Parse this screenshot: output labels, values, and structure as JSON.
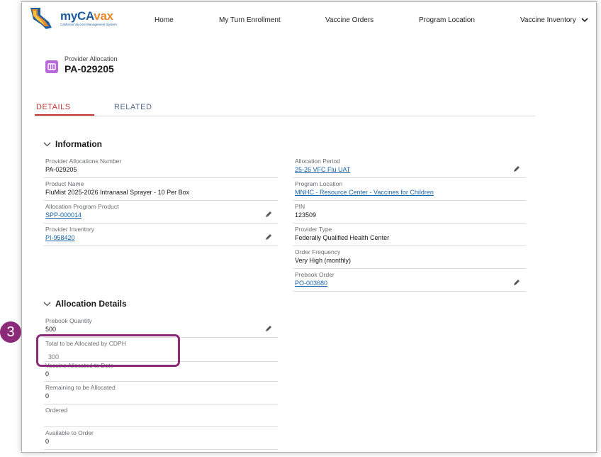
{
  "app": {
    "logo_main_1": "myCA",
    "logo_main_2": "vax",
    "logo_sub": "California Vaccine Management System"
  },
  "nav": {
    "items": [
      "Home",
      "My Turn Enrollment",
      "Vaccine Orders",
      "Program Location",
      "Vaccine Inventory"
    ]
  },
  "record": {
    "object_label": "Provider Allocation",
    "title": "PA-029205"
  },
  "tabs": [
    "DETAILS",
    "RELATED"
  ],
  "sections": {
    "information": "Information",
    "allocation_details": "Allocation Details"
  },
  "information": {
    "left": [
      {
        "label": "Provider Allocations Number",
        "value": "PA-029205"
      },
      {
        "label": "Product Name",
        "value": "FluMist 2025-2026 Intranasal Sprayer - 10 Per Box"
      },
      {
        "label": "Allocation Program Product",
        "value": "SPP-000014"
      },
      {
        "label": "Provider Inventory",
        "value": "PI-958420"
      }
    ],
    "right": [
      {
        "label": "Allocation Period",
        "value": "25-26 VFC Flu UAT"
      },
      {
        "label": "Program Location",
        "value": "MNHC - Resource Center - Vaccines for Children"
      },
      {
        "label": "PIN",
        "value": "123509"
      },
      {
        "label": "Provider Type",
        "value": "Federally Qualified Health Center"
      },
      {
        "label": "Order Frequency",
        "value": "Very High (monthly)"
      },
      {
        "label": "Prebook Order",
        "value": "PO-003680"
      }
    ]
  },
  "allocation": [
    {
      "label": "Prebook Quantity",
      "value": "500"
    },
    {
      "label": "Total to be Allocated by CDPH",
      "value": "300"
    },
    {
      "label": "Vaccine Allocated to Date",
      "value": "0"
    },
    {
      "label": "Remaining to be Allocated",
      "value": "0"
    },
    {
      "label": "Ordered",
      "value": ""
    },
    {
      "label": "Available to Order",
      "value": "0"
    }
  ],
  "callout": {
    "number": "3"
  },
  "colors": {
    "accent_tab": "#c23934",
    "link": "#1a63a6",
    "callout": "#8a2a78",
    "record_icon": "#b768d9"
  }
}
